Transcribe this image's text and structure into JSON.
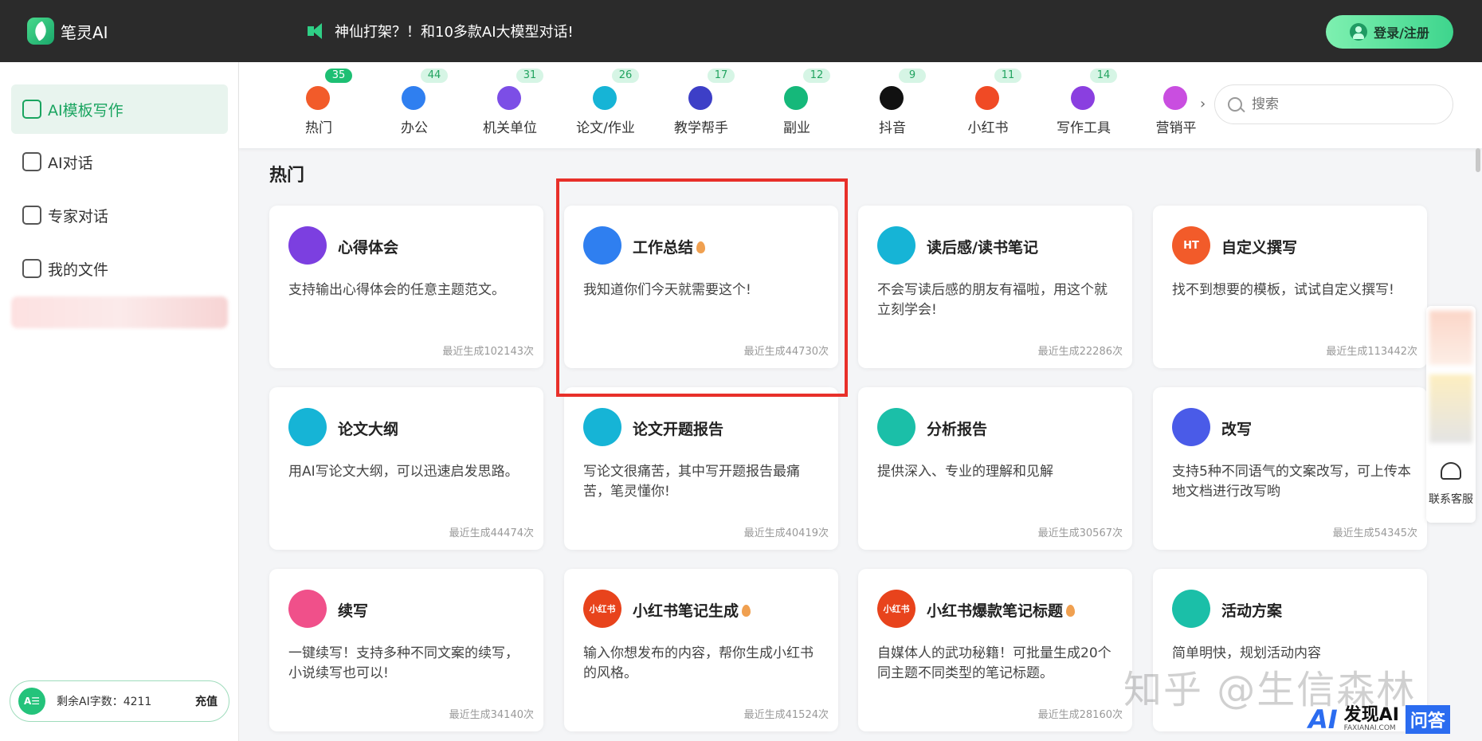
{
  "app": {
    "name": "笔灵AI"
  },
  "topbar": {
    "announcement": "神仙打架？！和10多款AI大模型对话!",
    "login_label": "登录/注册"
  },
  "sidebar": {
    "items": [
      {
        "label": "AI模板写作",
        "icon": "ai-template-icon",
        "active": true
      },
      {
        "label": "AI对话",
        "icon": "chat-icon"
      },
      {
        "label": "专家对话",
        "icon": "expert-icon"
      },
      {
        "label": "我的文件",
        "icon": "file-icon"
      }
    ],
    "quota": {
      "badge": "A☰",
      "label": "剩余AI字数：4211",
      "recharge": "充值"
    }
  },
  "categories": [
    {
      "label": "热门",
      "count": "35",
      "color": "#f25b2a"
    },
    {
      "label": "办公",
      "count": "44",
      "color": "#2f7ff0"
    },
    {
      "label": "机关单位",
      "count": "31",
      "color": "#7c4ee6"
    },
    {
      "label": "论文/作业",
      "count": "26",
      "color": "#16b4d6"
    },
    {
      "label": "教学帮手",
      "count": "17",
      "color": "#3d3fc7"
    },
    {
      "label": "副业",
      "count": "12",
      "color": "#15b87a"
    },
    {
      "label": "抖音",
      "count": "9",
      "color": "#111111"
    },
    {
      "label": "小红书",
      "count": "11",
      "color": "#f04a25"
    },
    {
      "label": "写作工具",
      "count": "14",
      "color": "#8a3fe0"
    },
    {
      "label": "营销平",
      "count": "",
      "color": "#c94ee0"
    }
  ],
  "search": {
    "placeholder": "搜索"
  },
  "section": {
    "title": "热门"
  },
  "cards": [
    {
      "title": "心得体会",
      "desc": "支持输出心得体会的任意主题范文。",
      "count": "最近生成102143次",
      "color": "#7c3fe0",
      "icon": "star-icon",
      "hot": false
    },
    {
      "title": "工作总结",
      "desc": "我知道你们今天就需要这个!",
      "count": "最近生成44730次",
      "color": "#2f7ff0",
      "icon": "briefcase-icon",
      "hot": true
    },
    {
      "title": "读后感/读书笔记",
      "desc": "不会写读后感的朋友有福啦，用这个就立刻学会!",
      "count": "最近生成22286次",
      "color": "#16b4d6",
      "icon": "book-icon",
      "hot": false
    },
    {
      "title": "自定义撰写",
      "desc": "找不到想要的模板，试试自定义撰写!",
      "count": "最近生成113442次",
      "color": "#f25b2a",
      "icon": "ht-flame-icon",
      "hot": false
    },
    {
      "title": "论文大纲",
      "desc": "用AI写论文大纲，可以迅速启发思路。",
      "count": "最近生成44474次",
      "color": "#16b4d6",
      "icon": "book-icon",
      "hot": false
    },
    {
      "title": "论文开题报告",
      "desc": "写论文很痛苦，其中写开题报告最痛苦，笔灵懂你!",
      "count": "最近生成40419次",
      "color": "#16b4d6",
      "icon": "book-icon",
      "hot": false
    },
    {
      "title": "分析报告",
      "desc": "提供深入、专业的理解和见解",
      "count": "最近生成30567次",
      "color": "#1bbfa8",
      "icon": "document-icon",
      "hot": false
    },
    {
      "title": "改写",
      "desc": "支持5种不同语气的文案改写，可上传本地文档进行改写哟",
      "count": "最近生成54345次",
      "color": "#4a5be8",
      "icon": "feather-icon",
      "hot": false
    },
    {
      "title": "续写",
      "desc": "一键续写！支持多种不同文案的续写，小说续写也可以!",
      "count": "最近生成34140次",
      "color": "#f0508a",
      "icon": "pen-icon",
      "hot": false
    },
    {
      "title": "小红书笔记生成",
      "desc": "输入你想发布的内容，帮你生成小红书的风格。",
      "count": "最近生成41524次",
      "color": "#e8431c",
      "icon": "xiaohongshu-icon",
      "hot": true
    },
    {
      "title": "小红书爆款笔记标题",
      "desc": "自媒体人的武功秘籍！可批量生成20个同主题不同类型的笔记标题。",
      "count": "最近生成28160次",
      "color": "#e8431c",
      "icon": "xiaohongshu-icon",
      "hot": true
    },
    {
      "title": "活动方案",
      "desc": "简单明快，规划活动内容",
      "count": "",
      "color": "#1bbfa8",
      "icon": "document-icon",
      "hot": false
    }
  ],
  "float": {
    "service_label": "联系客服"
  },
  "overlay": {
    "watermark": "知乎 @生信森林",
    "brand_a": "AI",
    "brand_main": "发现AI",
    "brand_sub": "FAXIANAI.COM",
    "brand_box": "问答"
  },
  "small_icon_text": {
    "ht": "HT",
    "xhs": "小红书"
  }
}
